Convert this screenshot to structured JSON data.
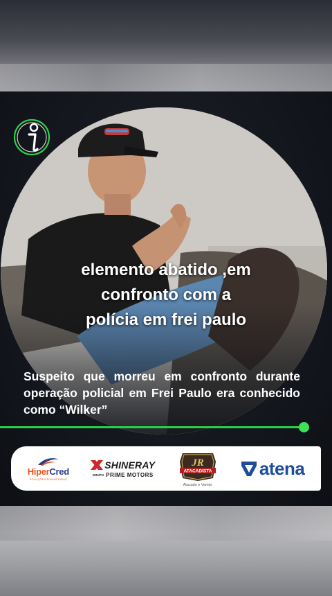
{
  "post": {
    "headline": [
      "elemento abatido ,em",
      "confronto com a",
      "polícia em frei paulo"
    ],
    "subtitle": "Suspeito que morreu em confronto durante operação policial em Frei Paulo era conhecido como “Wilker”",
    "progress_fraction": 0.92
  },
  "brand": {
    "logo_icon": "info-i-icon",
    "accent_color": "#2ad14a"
  },
  "sponsors": {
    "hipercred": {
      "name_a": "Hiper",
      "name_b": "Cred",
      "tagline": "SOLUÇÕES FINANCEIRAS"
    },
    "shineray": {
      "group": "GRUPO",
      "name": "SHINERAY",
      "sub": "PRIME MOTORS"
    },
    "jr": {
      "mark": "JR",
      "name": "ATACADISTA",
      "caption": "Atacado e Varejo"
    },
    "atena": {
      "name": "atena"
    }
  }
}
